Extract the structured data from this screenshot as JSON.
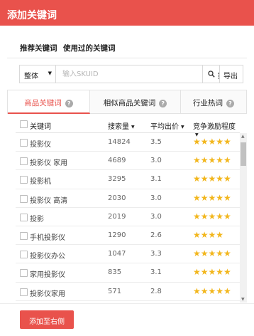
{
  "header": {
    "title": "添加关键词"
  },
  "modes": [
    "推荐关键词",
    "使用过的关键词"
  ],
  "search": {
    "scope": "整体",
    "placeholder": "输入SKUID",
    "button": "搜索",
    "export": "导出"
  },
  "tabs": [
    "商品关键词",
    "相似商品关键词",
    "行业热词"
  ],
  "table": {
    "headers": {
      "keyword": "关键词",
      "search_volume": "搜索量",
      "avg_price": "平均出价",
      "competition": "竞争激励程度"
    },
    "rows": [
      {
        "keyword": "投影仪",
        "search_volume": "14824",
        "avg_price": "3.5",
        "stars": "★★★★★"
      },
      {
        "keyword": "投影仪 家用",
        "search_volume": "4689",
        "avg_price": "3.0",
        "stars": "★★★★★"
      },
      {
        "keyword": "投影机",
        "search_volume": "3295",
        "avg_price": "3.1",
        "stars": "★★★★★"
      },
      {
        "keyword": "投影仪 高清",
        "search_volume": "2030",
        "avg_price": "3.0",
        "stars": "★★★★★"
      },
      {
        "keyword": "投影",
        "search_volume": "2019",
        "avg_price": "3.0",
        "stars": "★★★★★"
      },
      {
        "keyword": "手机投影仪",
        "search_volume": "1290",
        "avg_price": "2.6",
        "stars": "★★★★"
      },
      {
        "keyword": "投影仪办公",
        "search_volume": "1047",
        "avg_price": "3.3",
        "stars": "★★★★★"
      },
      {
        "keyword": "家用投影仪",
        "search_volume": "835",
        "avg_price": "3.1",
        "stars": "★★★★★"
      },
      {
        "keyword": "投影仪家用",
        "search_volume": "571",
        "avg_price": "2.8",
        "stars": "★★★★★"
      }
    ]
  },
  "footer": {
    "add_button": "添加至右侧"
  }
}
